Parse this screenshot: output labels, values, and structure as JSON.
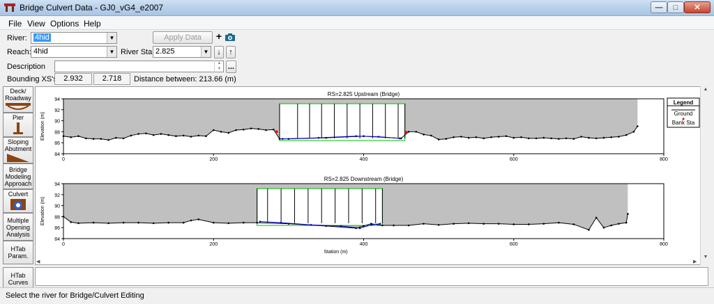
{
  "window": {
    "title": "Bridge Culvert Data - GJ0_vG4_e2007"
  },
  "menu": [
    "File",
    "View",
    "Options",
    "Help"
  ],
  "form": {
    "river_label": "River:",
    "river_value": "4hid",
    "reach_label": "Reach:",
    "reach_value": "4hid",
    "river_sta_label": "River Sta.:",
    "river_sta_value": "2.825",
    "apply_label": "Apply Data",
    "description_label": "Description",
    "bounding_label": "Bounding XS's:",
    "bounding_up": "2.932",
    "bounding_down": "2.718",
    "distance_text": "Distance between: 213.66 (m)"
  },
  "tools": [
    "Deck/ Roadway",
    "Pier",
    "Sloping Abutment",
    "Bridge Modeling Approach",
    "Culvert",
    "Multiple Opening Analysis",
    "HTab Param.",
    "HTab Curves"
  ],
  "legend": {
    "title": "Legend",
    "ground": "Ground",
    "bank": "Bank Sta"
  },
  "status": {
    "text": "Select the river for Bridge/Culvert Editing"
  },
  "colors": {
    "deck_fill": "#c0c0c0",
    "deck_top": "#ff0000",
    "opening_outline": "#00c000",
    "culvert_invert": "#0000cc",
    "ground": "#000000",
    "bank_station": "#ff0000"
  },
  "chart_data": [
    {
      "type": "line",
      "title": "RS=2.825   Upstream  (Bridge)",
      "xlabel": "",
      "ylabel": "Elevation (m)",
      "xlim": [
        0,
        800
      ],
      "ylim": [
        84,
        94
      ],
      "xticks": [
        0,
        200,
        400,
        600,
        800
      ],
      "yticks": [
        84,
        86,
        88,
        90,
        92,
        94
      ],
      "deck": {
        "x_start": 0,
        "x_end": 765,
        "top_elev": 94.0
      },
      "opening": {
        "x_start": 288,
        "x_end": 455,
        "top_elev": 93.1
      },
      "culvert_walls_x": [
        288,
        312,
        328,
        344,
        361,
        378,
        395,
        412,
        429,
        446,
        455
      ],
      "culvert_invert": {
        "x": [
          292,
          340,
          390,
          420,
          448
        ],
        "y": [
          86.7,
          86.9,
          87.2,
          87.1,
          86.8
        ]
      },
      "bank_stations": {
        "x": [
          284,
          457
        ],
        "y": [
          88.0,
          87.9
        ]
      },
      "ground": {
        "x": [
          0,
          10,
          20,
          30,
          40,
          50,
          60,
          70,
          80,
          90,
          100,
          110,
          120,
          130,
          140,
          150,
          160,
          170,
          180,
          190,
          200,
          210,
          220,
          230,
          240,
          250,
          260,
          270,
          280,
          288,
          300,
          350,
          400,
          450,
          460,
          470,
          480,
          490,
          500,
          510,
          520,
          530,
          540,
          550,
          560,
          570,
          580,
          590,
          600,
          610,
          620,
          630,
          640,
          650,
          660,
          670,
          680,
          690,
          700,
          710,
          720,
          730,
          740,
          750,
          760,
          765
        ],
        "y": [
          87.2,
          87.0,
          87.2,
          86.8,
          86.7,
          86.7,
          86.5,
          86.9,
          86.8,
          87.3,
          87.6,
          87.7,
          87.4,
          87.6,
          87.4,
          87.2,
          87.3,
          87.1,
          87.3,
          87.2,
          88.3,
          88.0,
          87.8,
          88.3,
          88.4,
          88.6,
          88.5,
          88.3,
          88.4,
          86.7,
          86.7,
          86.9,
          87.2,
          86.8,
          88.0,
          88.0,
          87.5,
          87.3,
          86.6,
          86.7,
          87.0,
          87.1,
          86.9,
          87.0,
          86.8,
          87.0,
          87.1,
          87.2,
          86.9,
          87.0,
          86.8,
          86.8,
          86.9,
          86.8,
          86.7,
          86.8,
          86.7,
          87.1,
          86.9,
          86.8,
          86.9,
          87.0,
          87.1,
          87.4,
          88.0,
          89.0
        ]
      }
    },
    {
      "type": "line",
      "title": "RS=2.825   Downstream  (Bridge)",
      "xlabel": "Station (m)",
      "ylabel": "Elevation (m)",
      "xlim": [
        0,
        800
      ],
      "ylim": [
        84,
        94
      ],
      "xticks": [
        0,
        200,
        400,
        600,
        800
      ],
      "yticks": [
        84,
        86,
        88,
        90,
        92,
        94
      ],
      "deck": {
        "x_start": 0,
        "x_end": 752,
        "top_elev": 94.0
      },
      "opening": {
        "x_start": 258,
        "x_end": 425,
        "top_elev": 93.1
      },
      "culvert_walls_x": [
        258,
        272,
        290,
        308,
        326,
        344,
        362,
        380,
        398,
        416,
        425
      ],
      "culvert_invert": {
        "x": [
          262,
          290,
          330,
          370,
          395,
          410,
          422
        ],
        "y": [
          87.1,
          86.9,
          86.5,
          86.3,
          85.9,
          86.5,
          86.7
        ]
      },
      "bank_stations": {
        "x": [],
        "y": []
      },
      "ground": {
        "x": [
          0,
          10,
          20,
          40,
          60,
          80,
          100,
          120,
          140,
          160,
          170,
          180,
          200,
          220,
          240,
          258,
          300,
          350,
          390,
          400,
          410,
          425,
          440,
          460,
          480,
          500,
          520,
          540,
          560,
          580,
          600,
          620,
          640,
          660,
          680,
          700,
          710,
          720,
          730,
          740,
          750,
          752
        ],
        "y": [
          88.0,
          87.0,
          86.8,
          86.9,
          86.8,
          86.9,
          86.9,
          86.8,
          86.9,
          86.9,
          87.3,
          87.5,
          86.9,
          86.8,
          86.9,
          86.9,
          86.7,
          86.3,
          85.9,
          86.3,
          86.7,
          86.4,
          86.4,
          86.4,
          86.7,
          86.5,
          86.7,
          86.8,
          86.7,
          86.7,
          86.6,
          86.6,
          86.7,
          86.9,
          86.6,
          85.6,
          87.8,
          86.0,
          86.4,
          86.7,
          86.9,
          88.5
        ]
      }
    }
  ]
}
